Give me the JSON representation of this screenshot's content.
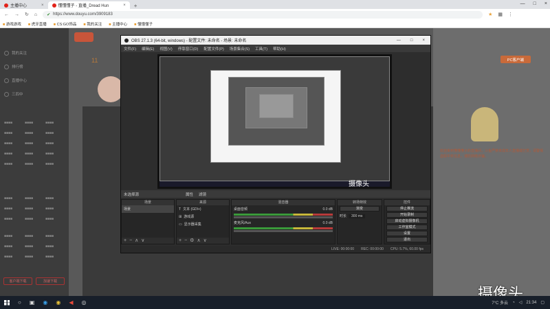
{
  "browser": {
    "tabs": [
      {
        "label": "主播中心",
        "active": false
      },
      {
        "label": "懂懂懂子 - 直播_Dread Hun",
        "active": true
      }
    ],
    "new_tab": "+",
    "url": "https://www.douyu.com/3909183",
    "bookmarks": [
      "游戏游戏",
      "虎牙直播",
      "CS:GO饰品",
      "我的关注",
      "主播中心",
      "懂懂懂子"
    ]
  },
  "site": {
    "room_count": "11",
    "side_items": [
      "我的关注",
      "排行榜",
      "直播中心",
      "三四中"
    ],
    "pc_button": "PC客户端",
    "bottom_buttons": [
      "客户端下载",
      "加速下载"
    ],
    "notice": "欢迎来到懂懂懂子的直播间，斗鱼严禁未成年人直播或打赏，请警惕虚假中奖信息，谨防网络诈骗。"
  },
  "obs": {
    "title": "OBS 27.1.3 (64-bit, windows) - 配置文件: 未命名 - 场景: 未命名",
    "menu": [
      "文件(F)",
      "编辑(E)",
      "视图(V)",
      "停靠窗口(D)",
      "配置文件(P)",
      "场景集合(S)",
      "工具(T)",
      "帮助(H)"
    ],
    "scene_bar": [
      "未选择源",
      "属性",
      "滤镜"
    ],
    "docks": {
      "scenes": {
        "title": "场景",
        "items": [
          "场景"
        ]
      },
      "sources": {
        "title": "来源",
        "items": [
          "文本 (GDI+)",
          "游戏源",
          "显示器采集"
        ]
      },
      "mixer": {
        "title": "混音器",
        "tracks": [
          {
            "name": "桌面音频",
            "db": "0.0 dB"
          },
          {
            "name": "麦克风/Aux",
            "db": "0.0 dB"
          }
        ]
      },
      "transitions": {
        "title": "转场特效",
        "type": "渐变",
        "duration_label": "时长",
        "duration": "300 ms"
      },
      "controls": {
        "title": "控件",
        "buttons": [
          "停止推流",
          "开始录制",
          "启动虚拟摄像机",
          "工作室模式",
          "设置",
          "退出"
        ]
      }
    },
    "status": {
      "live": "LIVE: 00:00:00",
      "rec": "REC: 00:00:00",
      "cpu": "CPU: 5.7%, 60.00 fps"
    }
  },
  "watermark": "摄像头",
  "taskbar": {
    "weather": "7°C 多云",
    "time": "21:34"
  }
}
